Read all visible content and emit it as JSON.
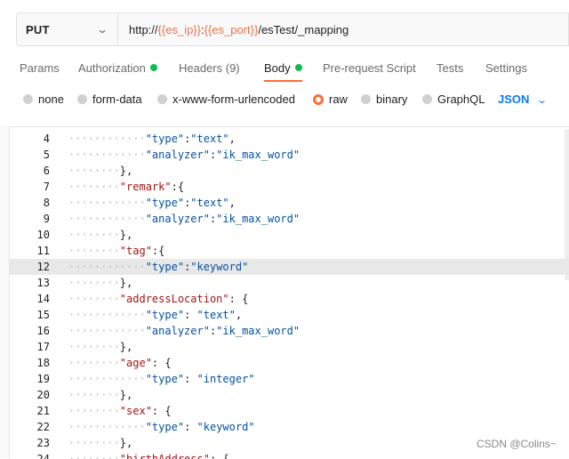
{
  "request": {
    "method": "PUT",
    "url_parts": [
      {
        "text": "http://",
        "var": false
      },
      {
        "text": "{{es_ip}}",
        "var": true
      },
      {
        "text": ":",
        "var": false
      },
      {
        "text": "{{es_port}}",
        "var": true
      },
      {
        "text": "/esTest/_mapping",
        "var": false
      }
    ]
  },
  "tabs": [
    {
      "label": "Params",
      "dot": false,
      "active": false
    },
    {
      "label": "Authorization",
      "dot": true,
      "active": false
    },
    {
      "label": "Headers (9)",
      "dot": false,
      "active": false
    },
    {
      "label": "Body",
      "dot": true,
      "active": true
    },
    {
      "label": "Pre-request Script",
      "dot": false,
      "active": false
    },
    {
      "label": "Tests",
      "dot": false,
      "active": false
    },
    {
      "label": "Settings",
      "dot": false,
      "active": false
    }
  ],
  "body_types": [
    {
      "label": "none",
      "selected": false
    },
    {
      "label": "form-data",
      "selected": false
    },
    {
      "label": "x-www-form-urlencoded",
      "selected": false
    },
    {
      "label": "raw",
      "selected": true
    },
    {
      "label": "binary",
      "selected": false
    },
    {
      "label": "GraphQL",
      "selected": false
    }
  ],
  "format_select": "JSON",
  "editor_lines": [
    {
      "n": "4",
      "dots": "............",
      "tokens": [
        [
          "s",
          "\"type\""
        ],
        [
          "p",
          ":"
        ],
        [
          "s",
          "\"text\""
        ],
        [
          "p",
          ","
        ]
      ]
    },
    {
      "n": "5",
      "dots": "............",
      "tokens": [
        [
          "s",
          "\"analyzer\""
        ],
        [
          "p",
          ":"
        ],
        [
          "s",
          "\"ik_max_word\""
        ]
      ]
    },
    {
      "n": "6",
      "dots": "........",
      "tokens": [
        [
          "p",
          "},"
        ]
      ]
    },
    {
      "n": "7",
      "dots": "........",
      "tokens": [
        [
          "k",
          "\"remark\""
        ],
        [
          "p",
          ":{"
        ]
      ]
    },
    {
      "n": "8",
      "dots": "............",
      "tokens": [
        [
          "s",
          "\"type\""
        ],
        [
          "p",
          ":"
        ],
        [
          "s",
          "\"text\""
        ],
        [
          "p",
          ","
        ]
      ]
    },
    {
      "n": "9",
      "dots": "............",
      "tokens": [
        [
          "s",
          "\"analyzer\""
        ],
        [
          "p",
          ":"
        ],
        [
          "s",
          "\"ik_max_word\""
        ]
      ]
    },
    {
      "n": "10",
      "dots": "........",
      "tokens": [
        [
          "p",
          "},"
        ]
      ]
    },
    {
      "n": "11",
      "dots": "........",
      "tokens": [
        [
          "k",
          "\"tag\""
        ],
        [
          "p",
          ":{"
        ]
      ]
    },
    {
      "n": "12",
      "dots": "............",
      "tokens": [
        [
          "s",
          "\"type\""
        ],
        [
          "p",
          ":"
        ],
        [
          "s",
          "\"keyword\""
        ]
      ]
    },
    {
      "n": "13",
      "dots": "........",
      "tokens": [
        [
          "p",
          "},"
        ]
      ]
    },
    {
      "n": "14",
      "dots": "........",
      "tokens": [
        [
          "k",
          "\"addressLocation\""
        ],
        [
          "p",
          ": {"
        ]
      ]
    },
    {
      "n": "15",
      "dots": "............",
      "tokens": [
        [
          "s",
          "\"type\""
        ],
        [
          "p",
          ": "
        ],
        [
          "s",
          "\"text\""
        ],
        [
          "p",
          ","
        ]
      ]
    },
    {
      "n": "16",
      "dots": "............",
      "tokens": [
        [
          "s",
          "\"analyzer\""
        ],
        [
          "p",
          ":"
        ],
        [
          "s",
          "\"ik_max_word\""
        ]
      ]
    },
    {
      "n": "17",
      "dots": "........",
      "tokens": [
        [
          "p",
          "},"
        ]
      ]
    },
    {
      "n": "18",
      "dots": "........",
      "tokens": [
        [
          "k",
          "\"age\""
        ],
        [
          "p",
          ": {"
        ]
      ]
    },
    {
      "n": "19",
      "dots": "............",
      "tokens": [
        [
          "s",
          "\"type\""
        ],
        [
          "p",
          ": "
        ],
        [
          "s",
          "\"integer\""
        ]
      ]
    },
    {
      "n": "20",
      "dots": "........",
      "tokens": [
        [
          "p",
          "},"
        ]
      ]
    },
    {
      "n": "21",
      "dots": "........",
      "tokens": [
        [
          "k",
          "\"sex\""
        ],
        [
          "p",
          ": {"
        ]
      ]
    },
    {
      "n": "22",
      "dots": "............",
      "tokens": [
        [
          "s",
          "\"type\""
        ],
        [
          "p",
          ": "
        ],
        [
          "s",
          "\"keyword\""
        ]
      ]
    },
    {
      "n": "23",
      "dots": "........",
      "tokens": [
        [
          "p",
          "},"
        ]
      ]
    },
    {
      "n": "24",
      "dots": "........",
      "tokens": [
        [
          "k",
          "\"birthAddress\""
        ],
        [
          "p",
          ": {"
        ]
      ]
    }
  ],
  "highlighted_line": "12",
  "watermark": "CSDN @Colins~",
  "colors": {
    "accent": "#ff6c37",
    "dot": "#0cbb52",
    "link": "#097bed",
    "variable": "#e8734a"
  }
}
